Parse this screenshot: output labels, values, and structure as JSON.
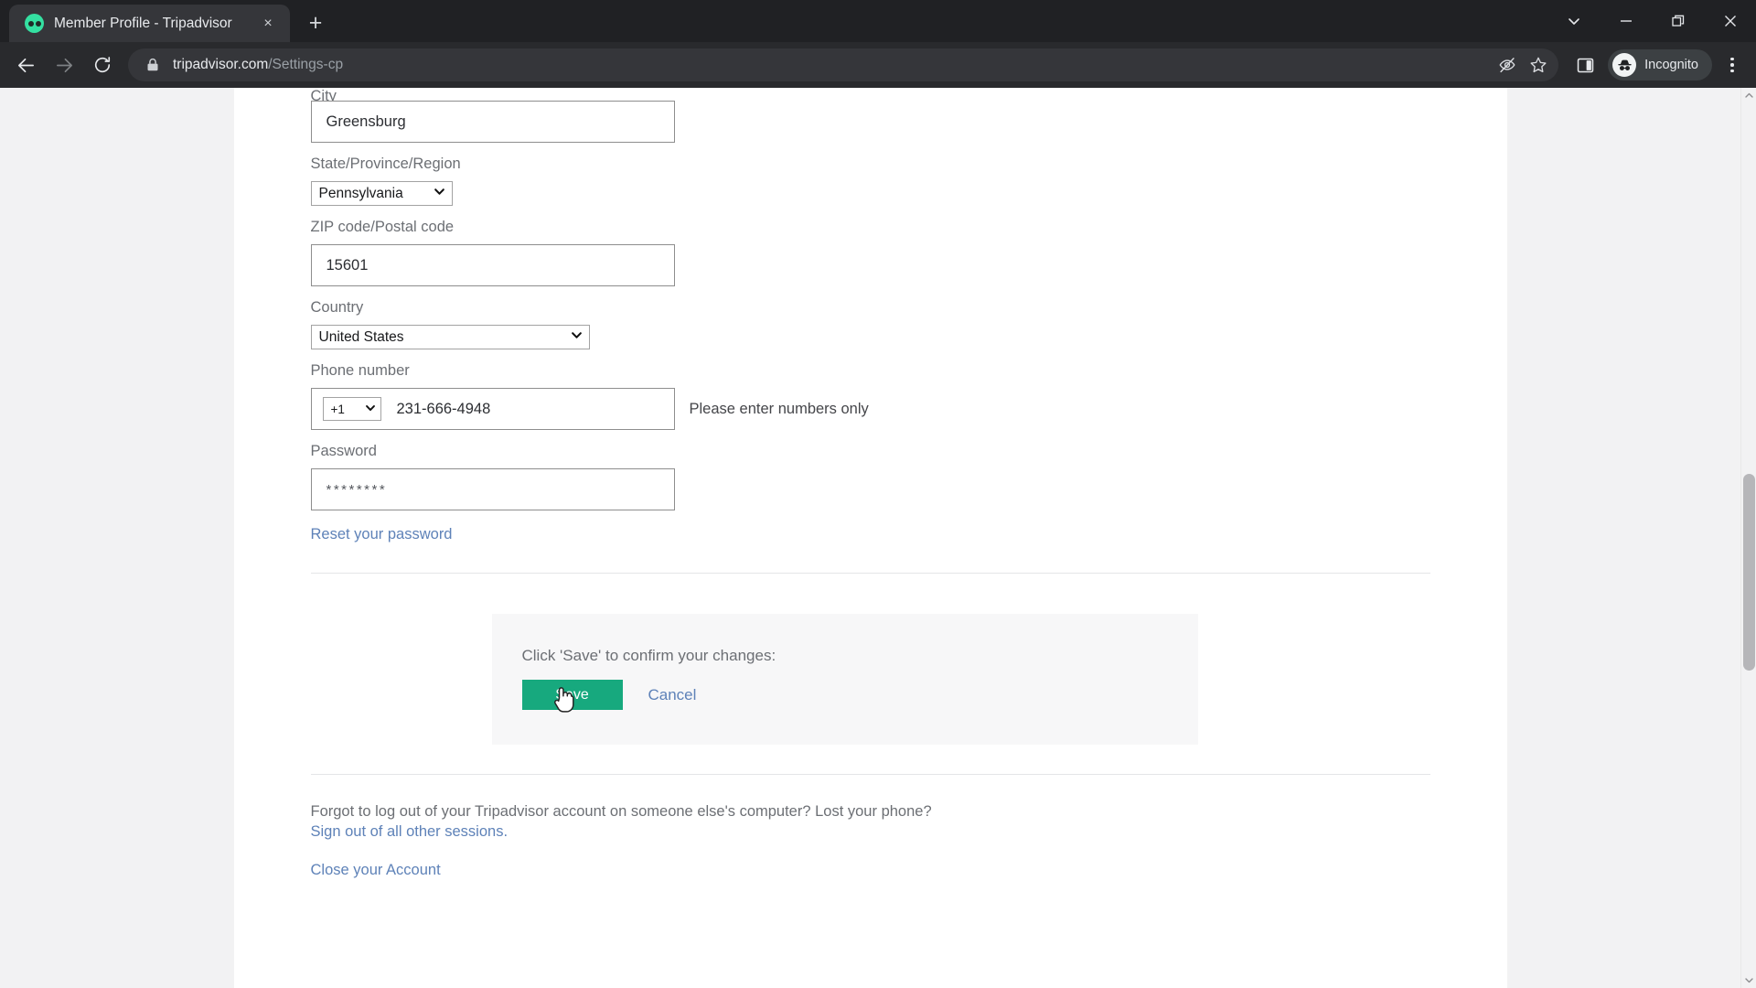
{
  "browser": {
    "tab": {
      "title": "Member Profile - Tripadvisor",
      "favicon": "tripadvisor-owl-icon",
      "close_label": "×"
    },
    "new_tab_label": "+",
    "window_controls": {
      "minimize": "–",
      "maximize": "❐",
      "close": "×",
      "tab_search": "tab-search-chevron"
    },
    "nav": {
      "back": "back-arrow-icon",
      "forward": "forward-arrow-icon",
      "reload": "reload-icon"
    },
    "omnibox": {
      "lock": "lock-icon",
      "host": "tripadvisor.com",
      "path": "/Settings-cp",
      "third_party_cookie": "eye-slash-icon",
      "bookmark": "star-icon"
    },
    "side_panel": "side-panel-icon",
    "profile": {
      "name": "Incognito",
      "avatar": "incognito-hat-icon"
    },
    "menu": "three-dot-menu-icon"
  },
  "form": {
    "city": {
      "label": "City",
      "value": "Greensburg"
    },
    "state": {
      "label": "State/Province/Region",
      "value": "Pennsylvania"
    },
    "zip": {
      "label": "ZIP code/Postal code",
      "value": "15601"
    },
    "country": {
      "label": "Country",
      "value": "United States"
    },
    "phone": {
      "label": "Phone number",
      "country_code": "+1",
      "value": "231-666-4948",
      "error": "Please enter numbers only"
    },
    "password": {
      "label": "Password",
      "value": "********",
      "reset_link": "Reset your password"
    }
  },
  "confirm": {
    "prompt": "Click 'Save' to confirm your changes:",
    "save_label": "Save",
    "cancel_label": "Cancel",
    "save_color": "#17a97e"
  },
  "footer": {
    "question": "Forgot to log out of your Tripadvisor account on someone else's computer? Lost your phone?",
    "signout_link": "Sign out of all other sessions.",
    "close_account_link": "Close your Account"
  },
  "scrollbar": {
    "up_arrow": "▲",
    "down_arrow": "▼"
  }
}
